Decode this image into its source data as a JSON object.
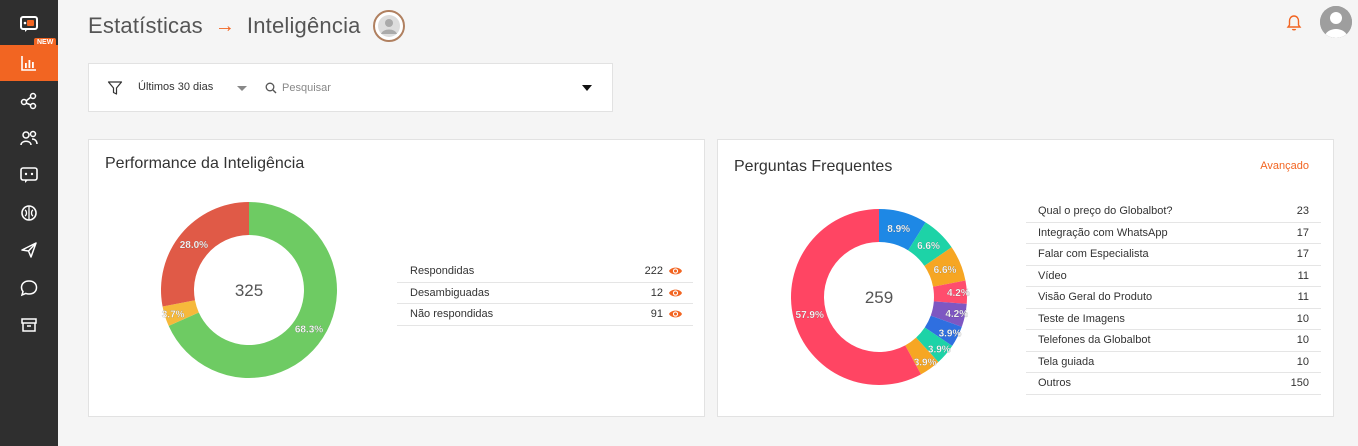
{
  "sidebar": {
    "new_badge": "NEW",
    "items": [
      {
        "icon": "logo-icon"
      },
      {
        "icon": "bar-chart-icon",
        "active": true
      },
      {
        "icon": "share-icon"
      },
      {
        "icon": "users-icon"
      },
      {
        "icon": "chatbot-icon"
      },
      {
        "icon": "brain-icon"
      },
      {
        "icon": "send-icon"
      },
      {
        "icon": "chat-bubble-icon"
      },
      {
        "icon": "archive-icon"
      }
    ]
  },
  "header": {
    "crumb_1": "Estatísticas",
    "arrow": "→",
    "crumb_2": "Inteligência"
  },
  "filter": {
    "period": "Últimos 30 dias",
    "search_placeholder": "Pesquisar"
  },
  "performance": {
    "title": "Performance da Inteligência",
    "total": "325",
    "rows": [
      {
        "label": "Respondidas",
        "value": "222"
      },
      {
        "label": "Desambiguadas",
        "value": "12"
      },
      {
        "label": "Não respondidas",
        "value": "91"
      }
    ]
  },
  "faq": {
    "title": "Perguntas Frequentes",
    "advanced": "Avançado",
    "total": "259",
    "rows": [
      {
        "label": "Qual o preço do Globalbot?",
        "value": "23"
      },
      {
        "label": "Integração com WhatsApp",
        "value": "17"
      },
      {
        "label": "Falar com Especialista",
        "value": "17"
      },
      {
        "label": "Vídeo",
        "value": "11"
      },
      {
        "label": "Visão Geral do Produto",
        "value": "11"
      },
      {
        "label": "Teste de Imagens",
        "value": "10"
      },
      {
        "label": "Telefones da Globalbot",
        "value": "10"
      },
      {
        "label": "Tela guiada",
        "value": "10"
      },
      {
        "label": "Outros",
        "value": "150"
      }
    ]
  },
  "chart_data": [
    {
      "type": "pie",
      "categories": [
        "Respondidas",
        "Desambiguadas",
        "Não respondidas"
      ],
      "values": [
        222,
        12,
        91
      ],
      "labels": [
        "68.3%",
        "3.7%",
        "28.0%"
      ],
      "colors": [
        "#6ecb63",
        "#f6b93b",
        "#e05a47"
      ]
    },
    {
      "type": "pie",
      "categories": [
        "Qual o preço do Globalbot?",
        "Integração com WhatsApp",
        "Falar com Especialista",
        "Vídeo",
        "Visão Geral do Produto",
        "Teste de Imagens",
        "Telefones da Globalbot",
        "Tela guiada",
        "Outros"
      ],
      "values": [
        23,
        17,
        17,
        11,
        11,
        10,
        10,
        10,
        150
      ],
      "labels": [
        "8.9%",
        "6.6%",
        "6.6%",
        "4.2%",
        "4.2%",
        "3.9%",
        "3.9%",
        "3.9%",
        "57.9%"
      ],
      "colors": [
        "#1e88e5",
        "#1dd3a7",
        "#f6a623",
        "#ff4d6d",
        "#7e57c2",
        "#2f6fe0",
        "#1dd3a7",
        "#f6a623",
        "#ff4563"
      ]
    }
  ]
}
